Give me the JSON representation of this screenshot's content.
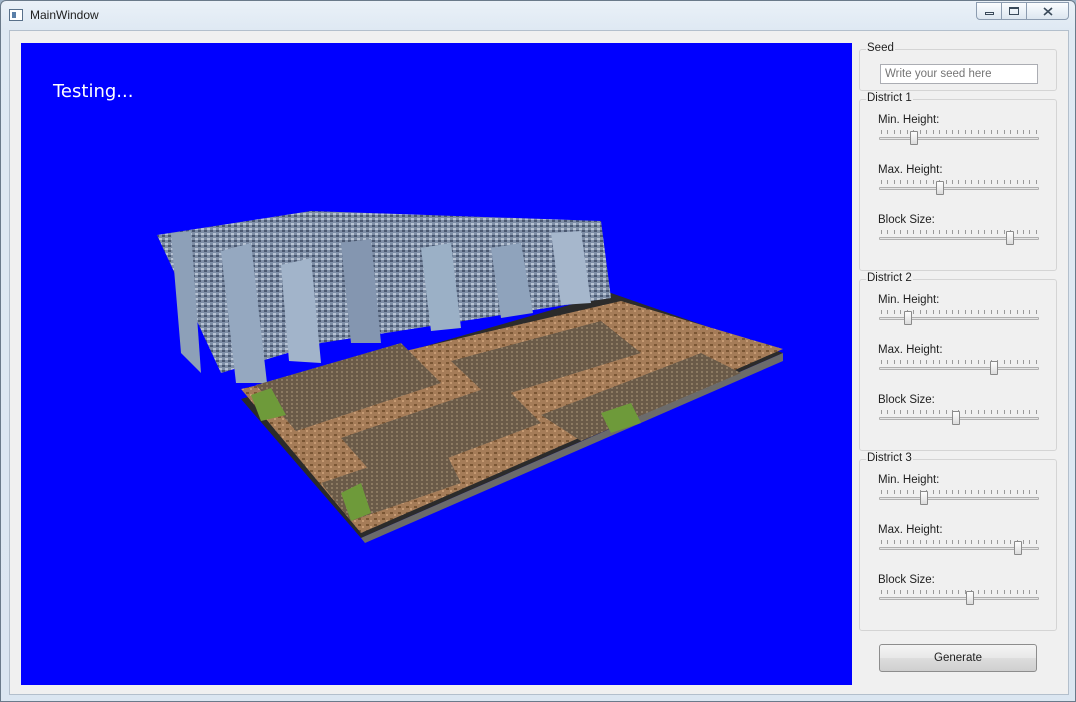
{
  "window": {
    "title": "MainWindow"
  },
  "icons": {
    "app": "app-window-icon",
    "minimize": "minimize-icon",
    "maximize": "maximize-icon",
    "close": "close-icon"
  },
  "viewport": {
    "label": "Testing...",
    "background": "#0000ff"
  },
  "seed": {
    "group_title": "Seed",
    "value": "",
    "placeholder": "Write your seed here"
  },
  "districts": [
    {
      "title": "District 1",
      "sliders": [
        {
          "label": "Min. Height:",
          "value": 0.22
        },
        {
          "label": "Max. Height:",
          "value": 0.38
        },
        {
          "label": "Block Size:",
          "value": 0.82
        }
      ]
    },
    {
      "title": "District 2",
      "sliders": [
        {
          "label": "Min. Height:",
          "value": 0.18
        },
        {
          "label": "Max. Height:",
          "value": 0.72
        },
        {
          "label": "Block Size:",
          "value": 0.48
        }
      ]
    },
    {
      "title": "District 3",
      "sliders": [
        {
          "label": "Min. Height:",
          "value": 0.28
        },
        {
          "label": "Max. Height:",
          "value": 0.87
        },
        {
          "label": "Block Size:",
          "value": 0.57
        }
      ]
    }
  ],
  "generate": {
    "label": "Generate"
  }
}
